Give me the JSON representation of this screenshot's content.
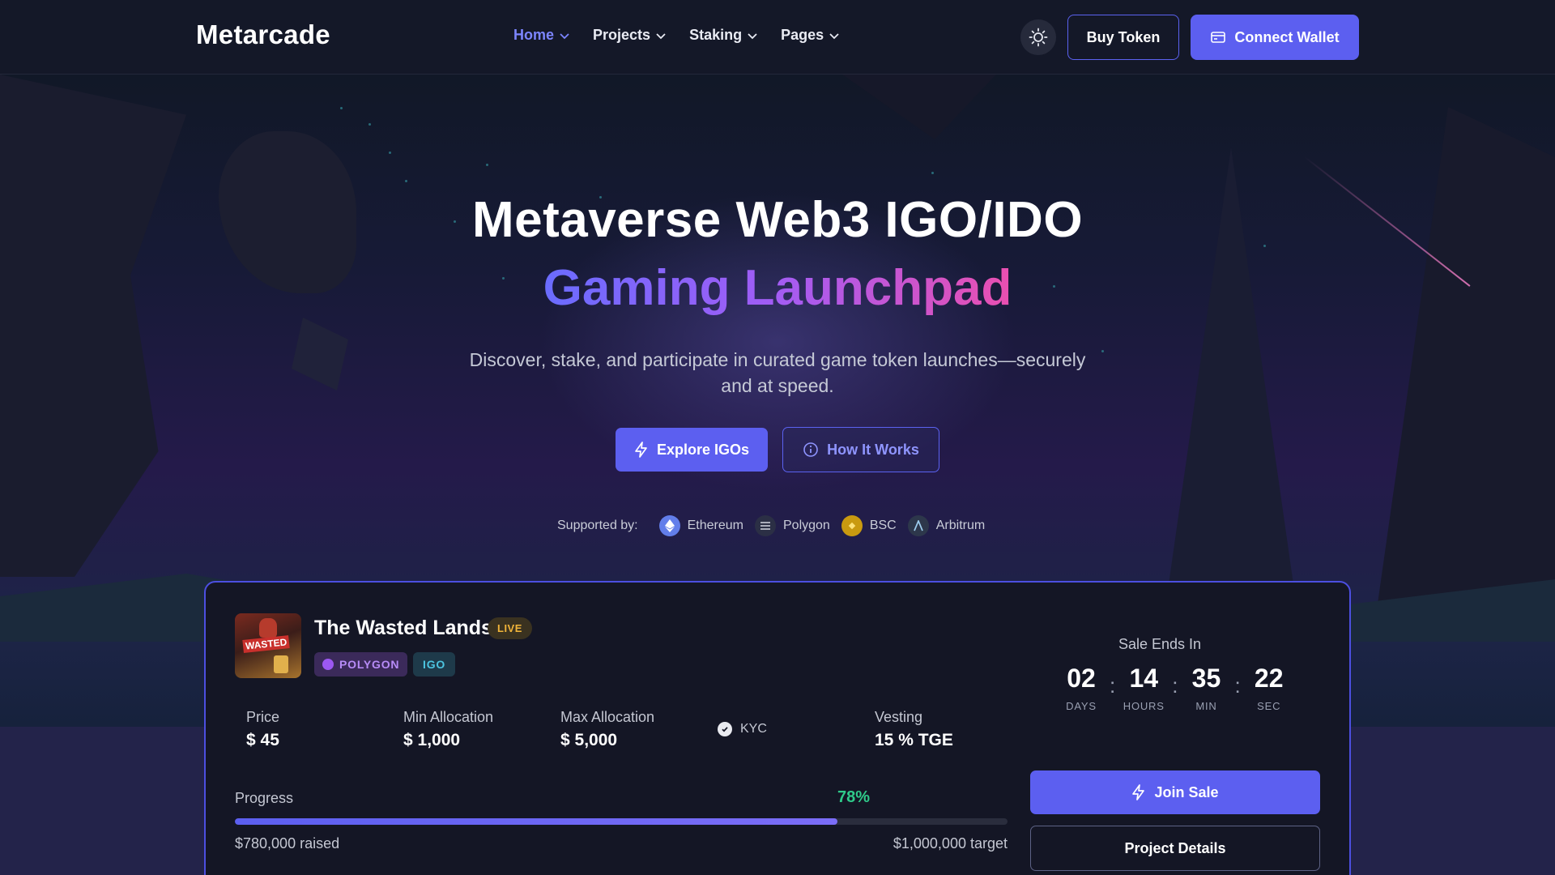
{
  "brand": {
    "logo": "Metarcade"
  },
  "nav": {
    "items": [
      {
        "label": "Home",
        "active": true
      },
      {
        "label": "Projects",
        "active": false
      },
      {
        "label": "Staking",
        "active": false
      },
      {
        "label": "Pages",
        "active": false
      }
    ],
    "theme_toggle_icon": "sun-icon",
    "buy_label": "Buy Token",
    "connect_label": "Connect Wallet"
  },
  "hero": {
    "title": "Metaverse Web3 IGO/IDO",
    "subtitle": "Gaming Launchpad",
    "description": "Discover, stake, and participate in curated game token launches—securely and at speed.",
    "explore_label": "Explore IGOs",
    "how_label": "How It Works",
    "supported_label": "Supported by:",
    "chains": [
      {
        "name": "Ethereum",
        "icon": "ethereum-icon",
        "color": "#627eea"
      },
      {
        "name": "Polygon",
        "icon": "polygon-icon",
        "color": "#2b2f45"
      },
      {
        "name": "BSC",
        "icon": "bsc-icon",
        "color": "#f0b90b"
      },
      {
        "name": "Arbitrum",
        "icon": "arbitrum-icon",
        "color": "#2d374b"
      }
    ]
  },
  "project": {
    "name": "The Wasted Lands",
    "status": "LIVE",
    "chain_tag": "POLYGON",
    "type_tag": "IGO",
    "thumb_text": "WASTED",
    "stats": {
      "price_label": "Price",
      "price_value": "$ 45",
      "min_label": "Min Allocation",
      "min_value": "$ 1,000",
      "max_label": "Max Allocation",
      "max_value": "$ 5,000",
      "kyc_label": "KYC",
      "vesting_label": "Vesting",
      "vesting_value": "15 % TGE"
    },
    "progress": {
      "label": "Progress",
      "percent_text": "78%",
      "fraction": 0.78,
      "raised": "$780,000 raised",
      "target": "$1,000,000 target"
    },
    "sale": {
      "title": "Sale Ends In",
      "days": "02",
      "days_label": "DAYS",
      "hours": "14",
      "hours_label": "HOURS",
      "min": "35",
      "min_label": "MIN",
      "sec": "22",
      "sec_label": "SEC"
    },
    "join_label": "Join Sale",
    "details_label": "Project Details"
  },
  "colors": {
    "accent": "#5c5ff0",
    "success": "#2fca8a",
    "live": "#f0b43a"
  }
}
